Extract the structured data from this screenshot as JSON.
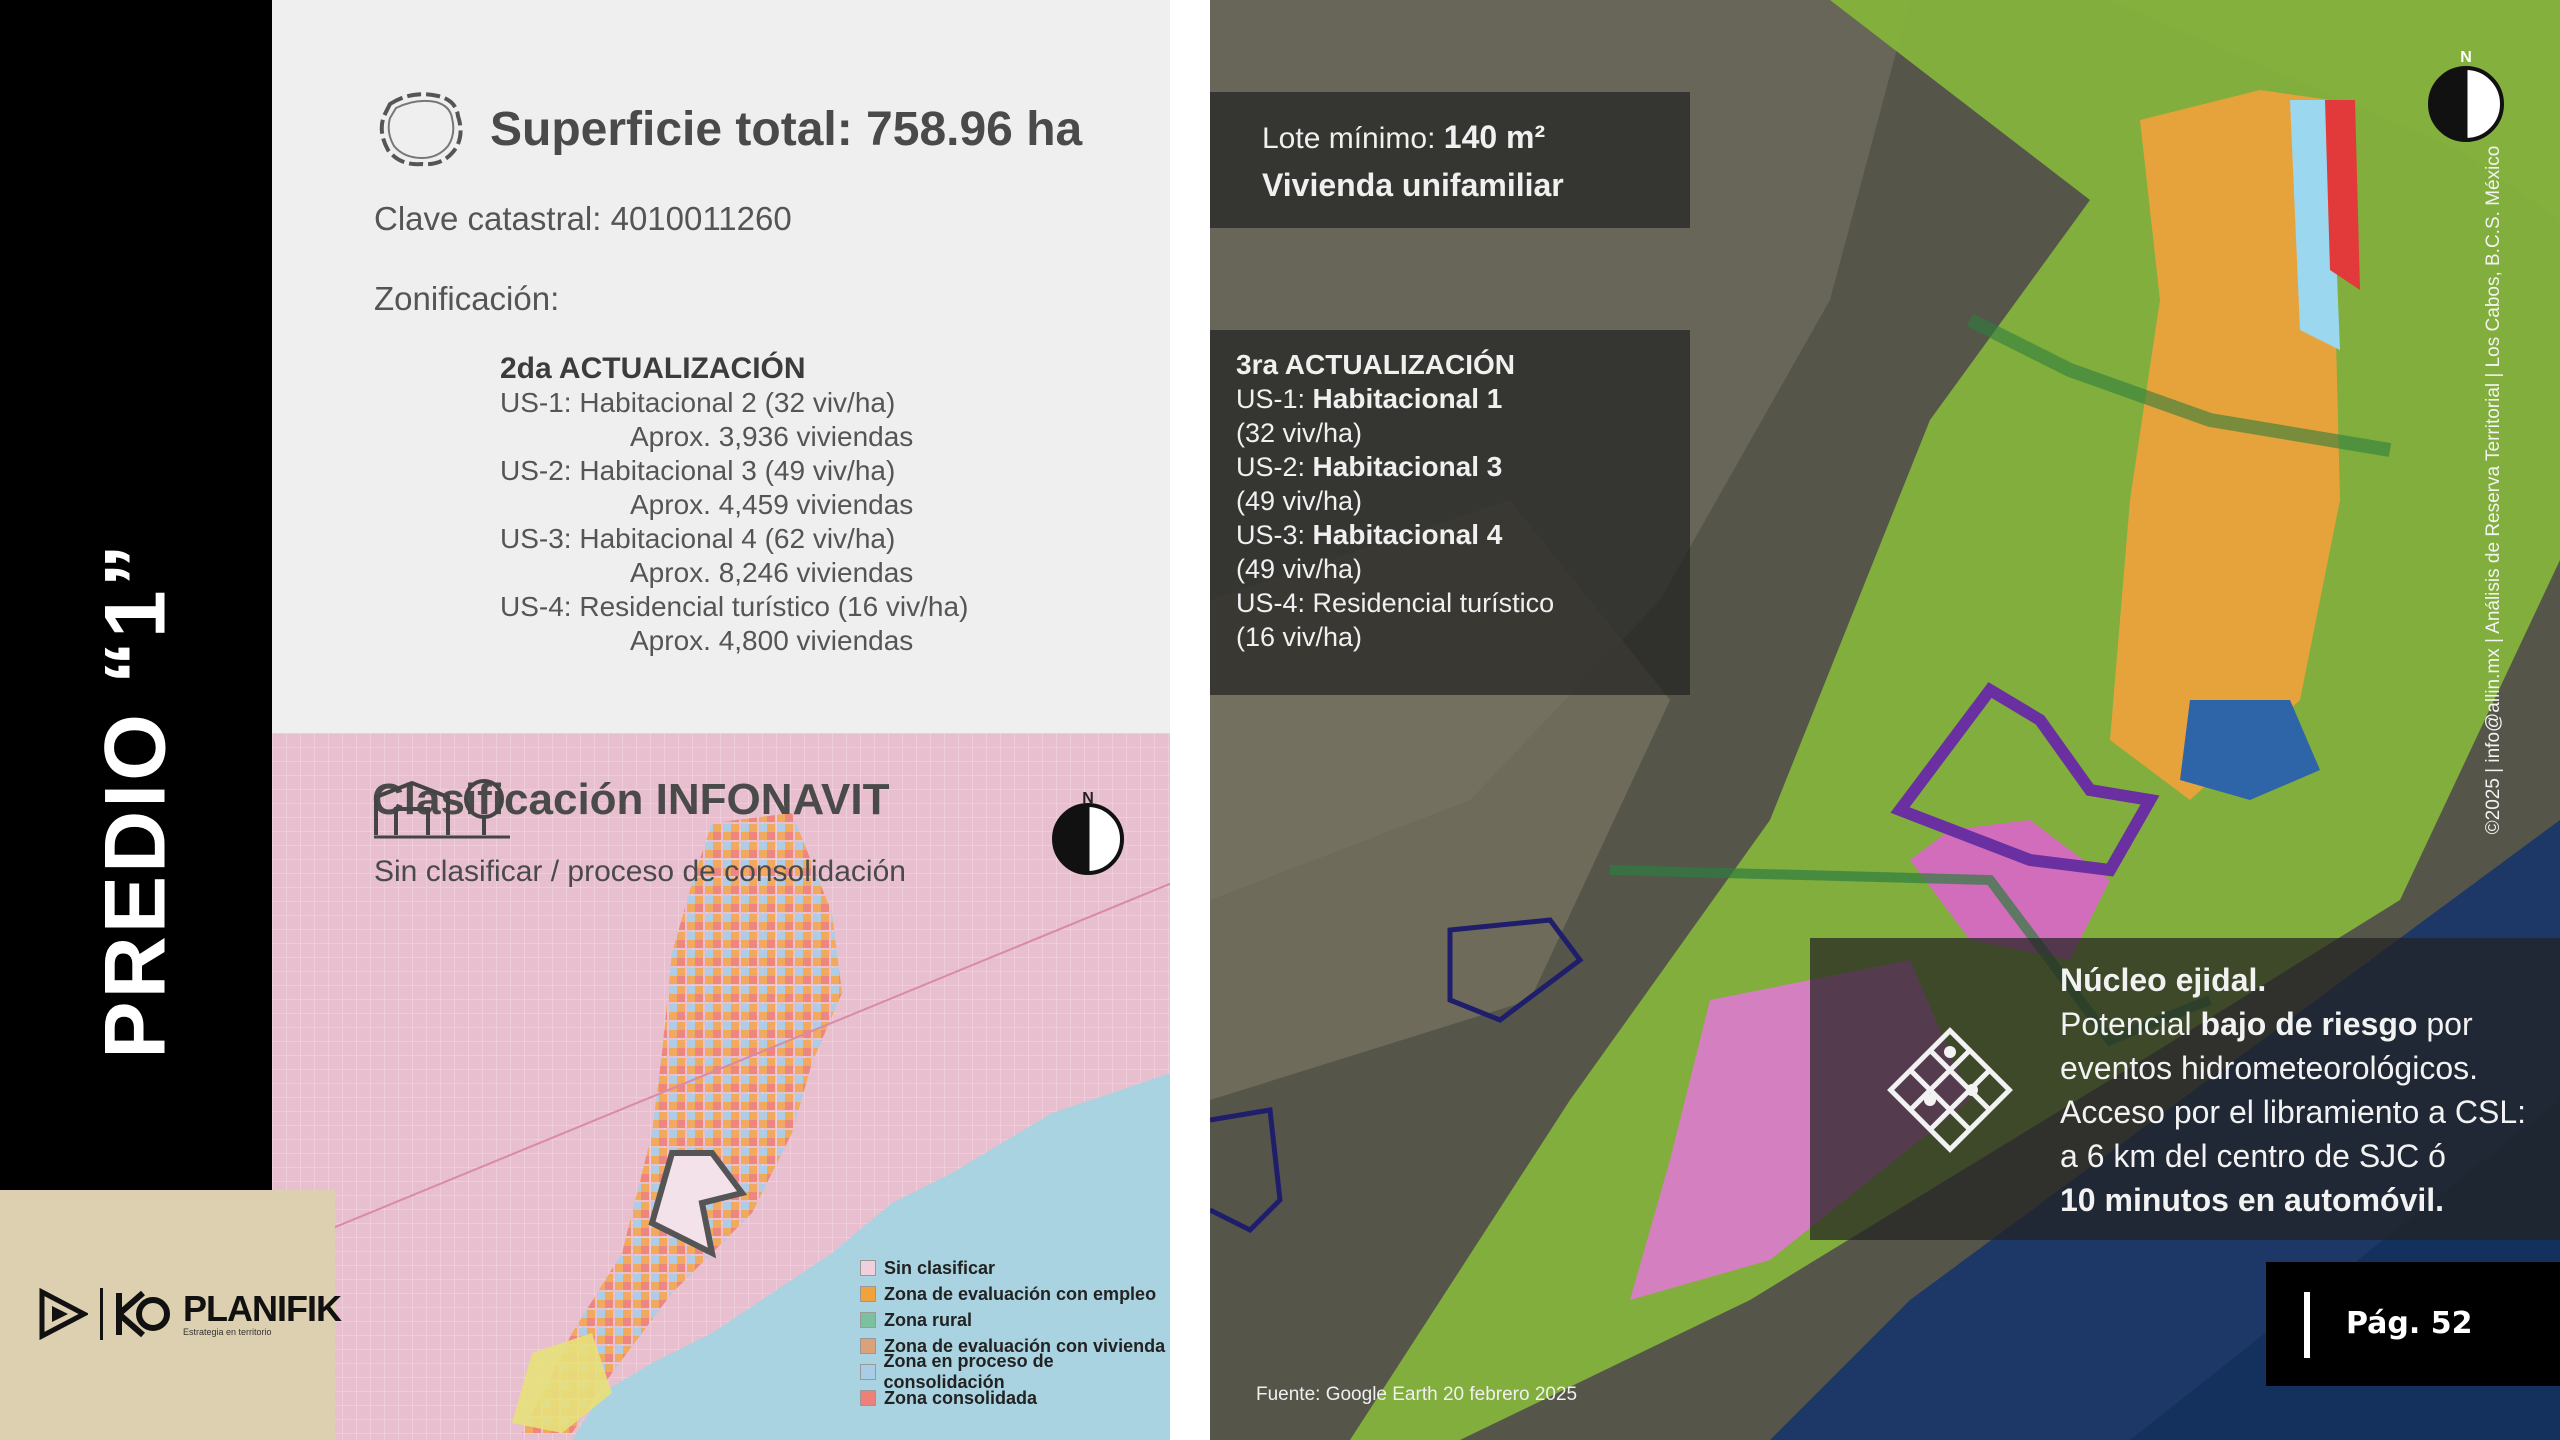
{
  "sidebar": {
    "vertical_title": "PREDIO “1”"
  },
  "info": {
    "superficie": "Superficie total: 758.96 ha",
    "clave": "Clave catastral: 4010011260",
    "zonificacion_label": "Zonificación:",
    "update_heading": "2da ACTUALIZACIÓN",
    "zones": [
      {
        "label": "US-1: Habitacional 2 (32 viv/ha)",
        "viviendas": "Aprox. 3,936 viviendas"
      },
      {
        "label": "US-2: Habitacional 3 (49 viv/ha)",
        "viviendas": "Aprox. 4,459 viviendas"
      },
      {
        "label": "US-3: Habitacional 4 (62 viv/ha)",
        "viviendas": "Aprox. 8,246 viviendas"
      },
      {
        "label": "US-4: Residencial turístico (16 viv/ha)",
        "viviendas": "Aprox. 4,800 viviendas"
      }
    ]
  },
  "infonavit": {
    "title": "Clasificación INFONAVIT",
    "subtitle": "Sin clasificar / proceso de consolidación",
    "compass": "N",
    "legend": [
      {
        "label": "Sin clasificar",
        "color": "#efd0dc"
      },
      {
        "label": "Zona de evaluación con empleo",
        "color": "#f2a23a"
      },
      {
        "label": "Zona rural",
        "color": "#7cc0a0"
      },
      {
        "label": "Zona de evaluación con vivienda",
        "color": "#d9a27a"
      },
      {
        "label": "Zona en proceso de consolidación",
        "color": "#a8cde6"
      },
      {
        "label": "Zona consolidada",
        "color": "#ef8077"
      }
    ]
  },
  "logo": {
    "name": "PLANIFIK",
    "tagline": "Estrategia en territorio"
  },
  "right_map": {
    "lote_label": "Lote mínimo:",
    "lote_value": "140 m²",
    "lote_type": "Vivienda unifamiliar",
    "update_heading": "3ra ACTUALIZACIÓN",
    "zones": [
      {
        "code": "US-1:",
        "name": "Habitacional 1",
        "density": "(32 viv/ha)"
      },
      {
        "code": "US-2:",
        "name": "Habitacional 3",
        "density": "(49 viv/ha)"
      },
      {
        "code": "US-3:",
        "name": "Habitacional 4",
        "density": "(49 viv/ha)"
      },
      {
        "code": "US-4:",
        "name": "Residencial turístico",
        "density": "(16 viv/ha)"
      }
    ],
    "nucleo_title": "Núcleo ejidal.",
    "riesgo_prefix": "Potencial",
    "riesgo_bold": "bajo de riesgo",
    "riesgo_suffix": "por eventos hidrometeorológicos.",
    "acceso": "Acceso por el libramiento a CSL: a 6 km del centro de SJC ó",
    "tiempo": "10 minutos en automóvil.",
    "credit": "©2025 | info@allin.mx | Análisis de Reserva Territorial | Los Cabos, B.C.S. México",
    "fuente": "Fuente: Google Earth 20 febrero 2025",
    "compass": "N"
  },
  "page": {
    "label": "Pág. 52"
  }
}
